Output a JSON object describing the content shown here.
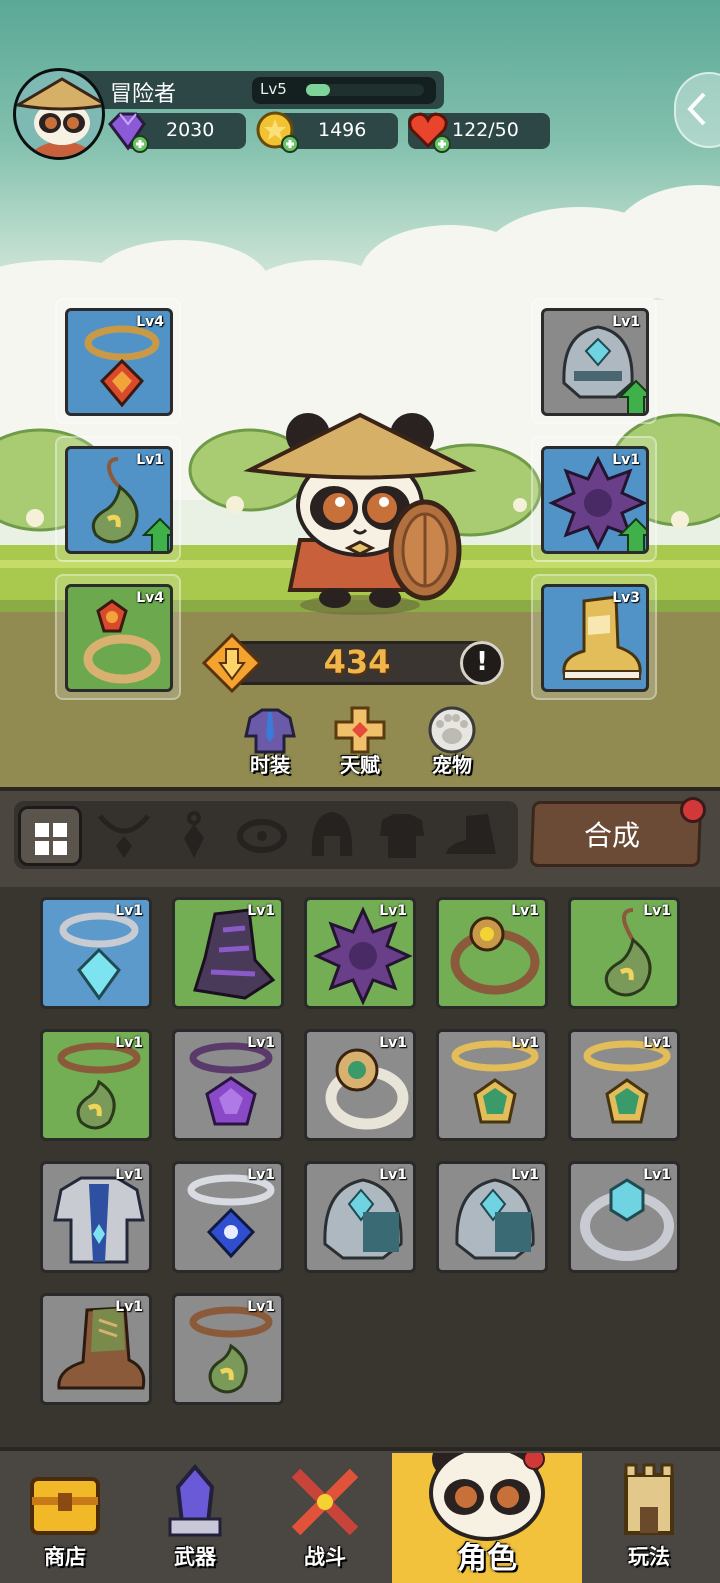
{
  "player": {
    "name": "冒险者",
    "level": "Lv5",
    "exp_fraction": 0.2
  },
  "resources": {
    "gems": "2030",
    "coins": "1496",
    "stamina": "122/50"
  },
  "equipped_slots": [
    {
      "slot": "necklace",
      "level": "Lv4",
      "bg": "blue"
    },
    {
      "slot": "amulet",
      "level": "Lv1",
      "bg": "blue",
      "upgrade": true
    },
    {
      "slot": "ring",
      "level": "Lv4",
      "bg": "green"
    },
    {
      "slot": "helmet",
      "level": "Lv1",
      "bg": "gray",
      "upgrade": true
    },
    {
      "slot": "armor",
      "level": "Lv1",
      "bg": "blue",
      "upgrade": true
    },
    {
      "slot": "boots",
      "level": "Lv3",
      "bg": "blue"
    }
  ],
  "power": {
    "value": "434",
    "info_symbol": "!"
  },
  "character_buttons": {
    "fashion": "时装",
    "talent": "天赋",
    "pet": "宠物"
  },
  "inventory_filters": [
    "all",
    "necklace",
    "amulet",
    "ring",
    "helmet",
    "armor",
    "boots"
  ],
  "craft_button": "合成",
  "inventory": [
    {
      "item": "crystal-necklace",
      "level": "Lv1",
      "bg": "blue"
    },
    {
      "item": "purple-gauntlet",
      "level": "Lv1",
      "bg": "green"
    },
    {
      "item": "purple-spiked-armor",
      "level": "Lv1",
      "bg": "green"
    },
    {
      "item": "flower-ring",
      "level": "Lv1",
      "bg": "green"
    },
    {
      "item": "jade-amulet",
      "level": "Lv1",
      "bg": "green"
    },
    {
      "item": "jade-necklace",
      "level": "Lv1",
      "bg": "green"
    },
    {
      "item": "amethyst-necklace",
      "level": "Lv1",
      "bg": "gray"
    },
    {
      "item": "emerald-ring",
      "level": "Lv1",
      "bg": "gray"
    },
    {
      "item": "gold-emerald-necklace",
      "level": "Lv1",
      "bg": "gray"
    },
    {
      "item": "gold-emerald-necklace",
      "level": "Lv1",
      "bg": "gray"
    },
    {
      "item": "blue-plate-armor",
      "level": "Lv1",
      "bg": "gray"
    },
    {
      "item": "sapphire-necklace",
      "level": "Lv1",
      "bg": "gray"
    },
    {
      "item": "steel-helmet",
      "level": "Lv1",
      "bg": "gray"
    },
    {
      "item": "steel-helmet",
      "level": "Lv1",
      "bg": "gray"
    },
    {
      "item": "crystal-ring",
      "level": "Lv1",
      "bg": "gray"
    },
    {
      "item": "leather-boots",
      "level": "Lv1",
      "bg": "gray"
    },
    {
      "item": "jade-necklace",
      "level": "Lv1",
      "bg": "gray"
    }
  ],
  "nav": [
    {
      "label": "商店",
      "icon": "chest-icon"
    },
    {
      "label": "武器",
      "icon": "weapon-altar-icon"
    },
    {
      "label": "战斗",
      "icon": "crossed-swords-icon"
    },
    {
      "label": "角色",
      "icon": "panda-icon",
      "active": true
    },
    {
      "label": "玩法",
      "icon": "castle-icon"
    }
  ],
  "colors": {
    "slot_blue": "#5193c7",
    "slot_green": "#6ba84e",
    "slot_gray": "#8a8a8a",
    "power_text": "#f0b64a",
    "nav_active": "#f2c23c"
  }
}
